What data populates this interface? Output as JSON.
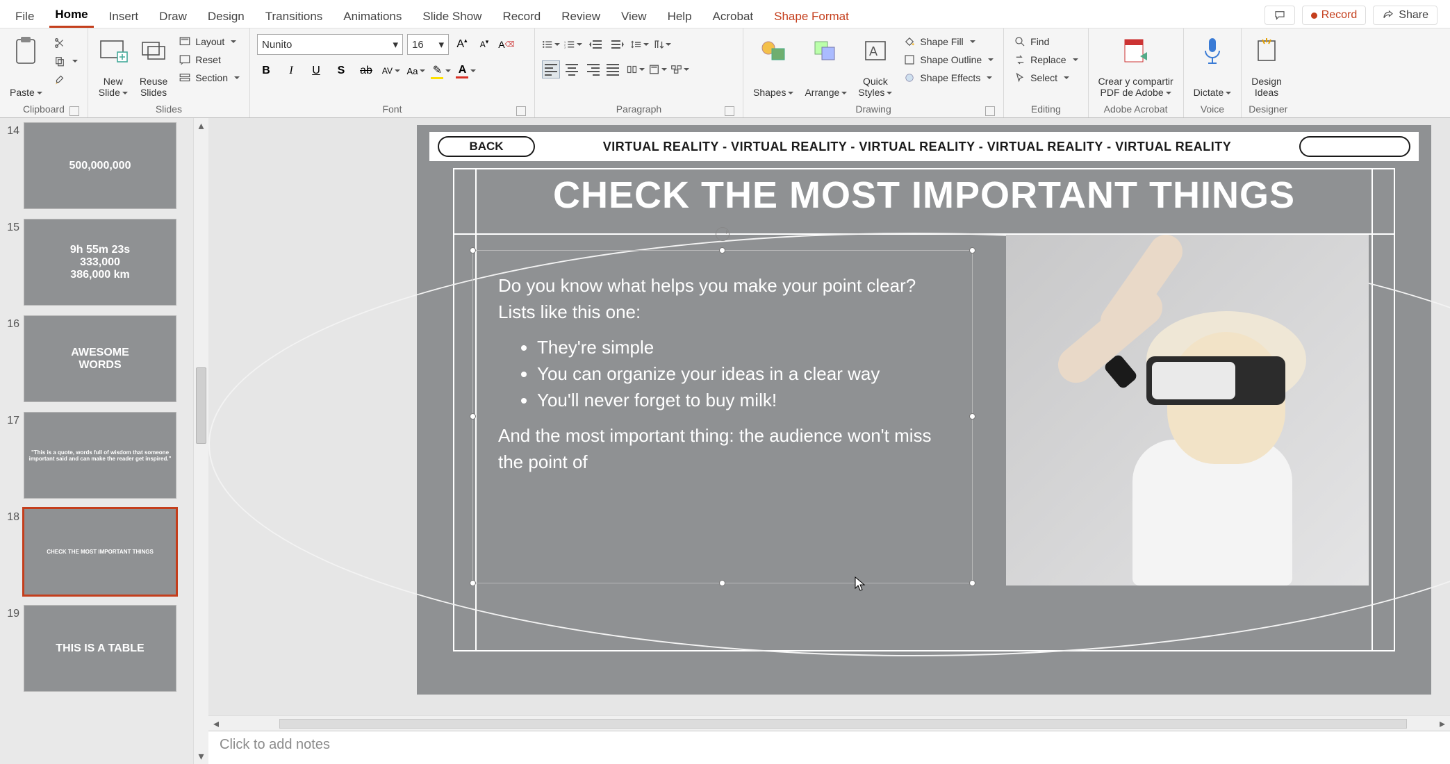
{
  "tabs": {
    "file": "File",
    "home": "Home",
    "insert": "Insert",
    "draw": "Draw",
    "design": "Design",
    "transitions": "Transitions",
    "animations": "Animations",
    "slideshow": "Slide Show",
    "record": "Record",
    "review": "Review",
    "view": "View",
    "help": "Help",
    "acrobat": "Acrobat",
    "shapeformat": "Shape Format"
  },
  "titlebar_buttons": {
    "record": "Record",
    "share": "Share"
  },
  "groups": {
    "clipboard": {
      "label": "Clipboard",
      "paste": "Paste"
    },
    "slides": {
      "label": "Slides",
      "new_slide": "New\nSlide",
      "reuse_slides": "Reuse\nSlides",
      "layout": "Layout",
      "reset": "Reset",
      "section": "Section"
    },
    "font": {
      "label": "Font",
      "font_name": "Nunito",
      "font_size": "16"
    },
    "paragraph": {
      "label": "Paragraph"
    },
    "drawing": {
      "label": "Drawing",
      "shapes": "Shapes",
      "arrange": "Arrange",
      "quick_styles": "Quick\nStyles",
      "shape_fill": "Shape Fill",
      "shape_outline": "Shape Outline",
      "shape_effects": "Shape Effects"
    },
    "editing": {
      "label": "Editing",
      "find": "Find",
      "replace": "Replace",
      "select": "Select"
    },
    "adobe": {
      "label": "Adobe Acrobat",
      "button": "Crear y compartir\nPDF de Adobe"
    },
    "voice": {
      "label": "Voice",
      "dictate": "Dictate"
    },
    "designer": {
      "label": "Designer",
      "ideas": "Design\nIdeas"
    }
  },
  "thumbs": [
    {
      "num": "14",
      "caption": "500,000,000"
    },
    {
      "num": "15",
      "caption": "9h 55m 23s\n333,000\n386,000 km"
    },
    {
      "num": "16",
      "caption": "AWESOME\nWORDS"
    },
    {
      "num": "17",
      "caption": "\"This is a quote, words full of wisdom that someone important said and can make the reader get inspired.\""
    },
    {
      "num": "18",
      "caption": "CHECK THE MOST IMPORTANT THINGS",
      "selected": true
    },
    {
      "num": "19",
      "caption": "THIS IS A TABLE"
    }
  ],
  "slide": {
    "back": "BACK",
    "vr_strip": "VIRTUAL REALITY  - VIRTUAL REALITY - VIRTUAL REALITY  - VIRTUAL REALITY - VIRTUAL REALITY",
    "title": "CHECK THE MOST IMPORTANT THINGS",
    "intro": "Do you know what helps you make your point clear? Lists like this one:",
    "bullets": [
      "They're simple",
      "You can organize your ideas in a clear way",
      "You'll never forget to buy milk!"
    ],
    "outro": "And the most important thing: the audience won't miss the point of"
  },
  "notes_placeholder": "Click to add notes"
}
